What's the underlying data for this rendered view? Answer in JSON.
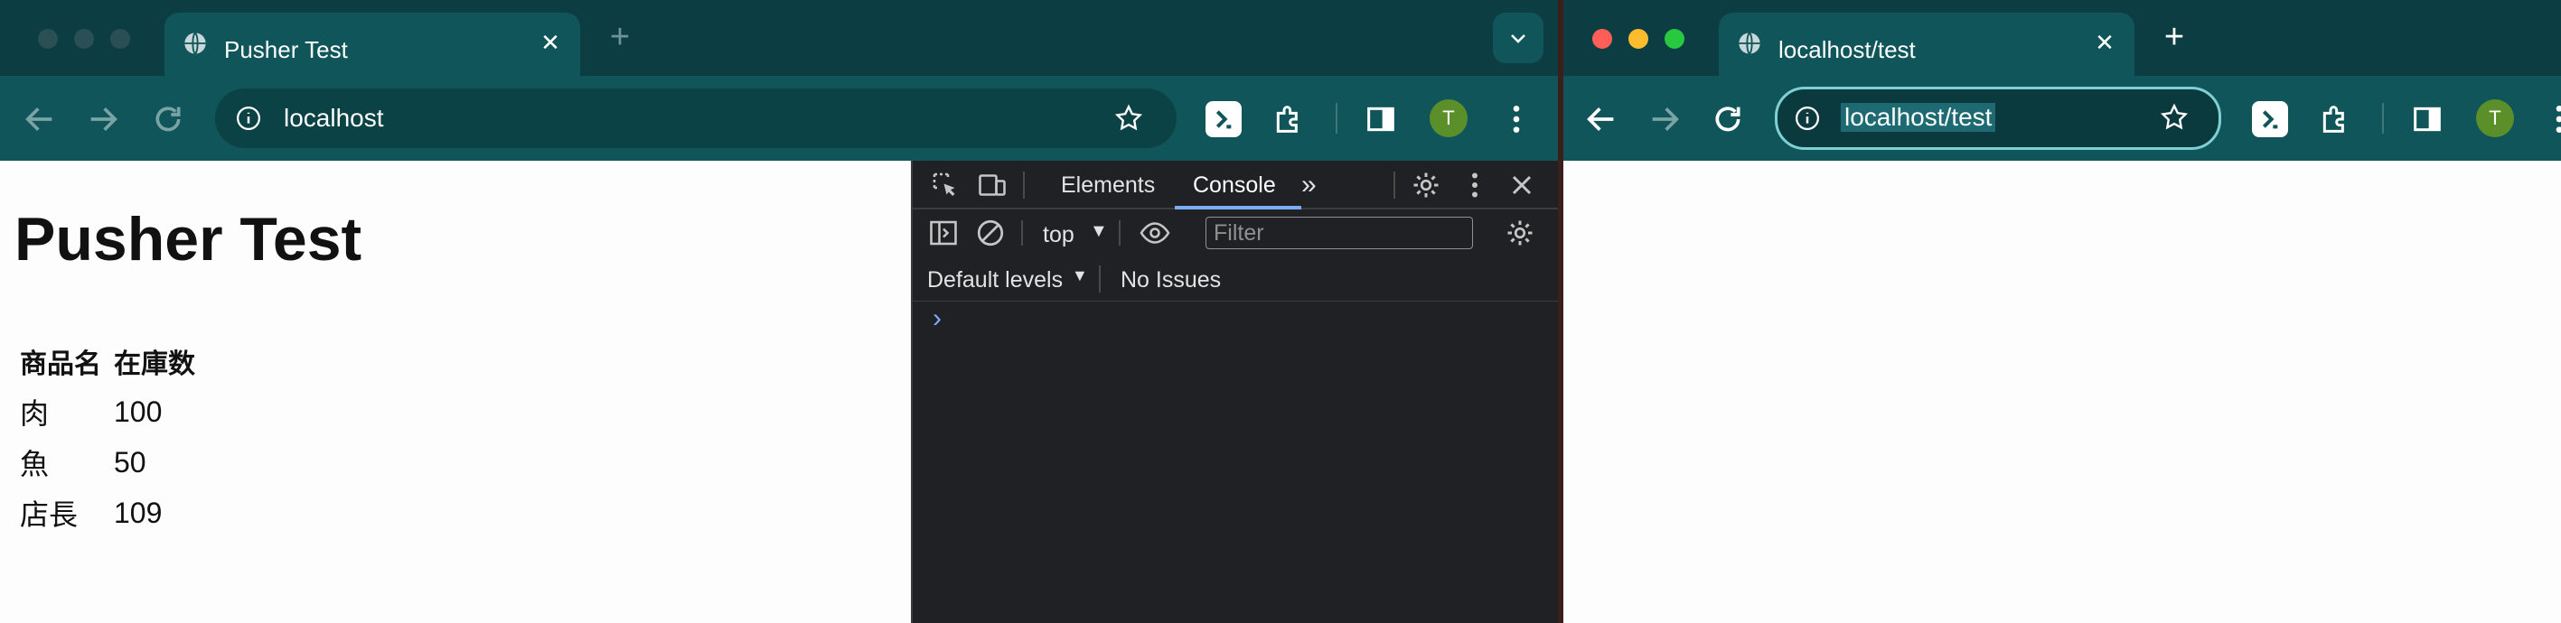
{
  "left_window": {
    "tab": {
      "title": "Pusher Test"
    },
    "omnibox": {
      "url": "localhost"
    },
    "avatar_initial": "T",
    "page": {
      "title": "Pusher Test",
      "table": {
        "headers": [
          "商品名",
          "在庫数"
        ],
        "rows": [
          [
            "肉",
            "100"
          ],
          [
            "魚",
            "50"
          ],
          [
            "店長",
            "109"
          ]
        ]
      }
    },
    "devtools": {
      "tabs": [
        "Elements",
        "Console"
      ],
      "active_tab": "Console",
      "context": "top",
      "filter_placeholder": "Filter",
      "levels": "Default levels",
      "issues": "No Issues",
      "prompt": "›"
    }
  },
  "right_window": {
    "tab": {
      "title": "localhost/test"
    },
    "omnibox": {
      "url": "localhost/test"
    },
    "avatar_initial": "T"
  },
  "colors": {
    "tabbar": "#0b3d43",
    "toolbar": "#0f5559",
    "devtools_bg": "#202124",
    "console_accent": "#7cacf8",
    "avatar": "#5a8f2a"
  }
}
